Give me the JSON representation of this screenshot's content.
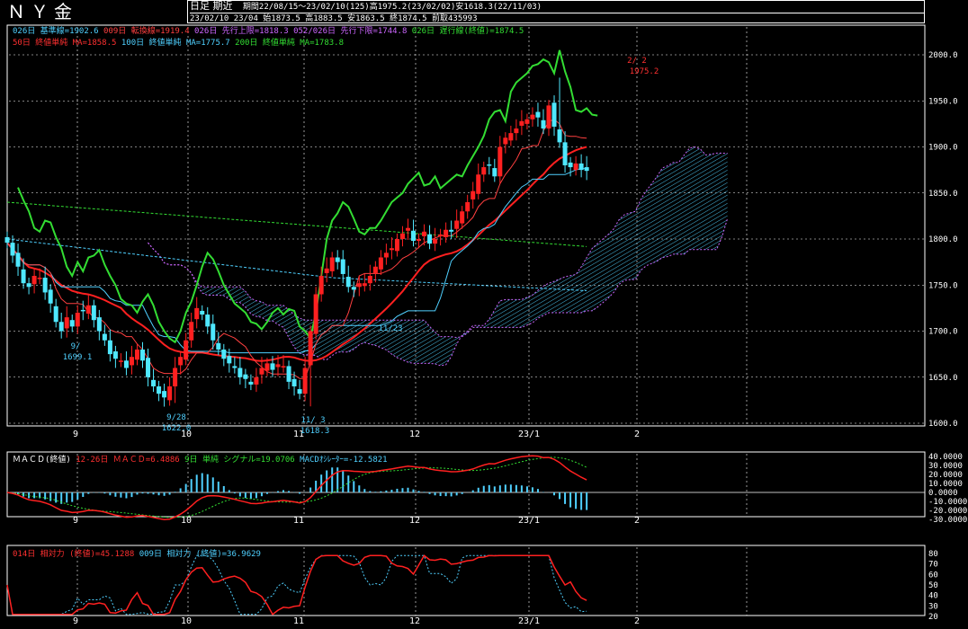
{
  "header": {
    "title": "ＮＹ金",
    "period_type": "日足 期近",
    "range_info": "期間22/08/15～23/02/10(125)高1975.2(23/02/02)安1618.3(22/11/03)",
    "ohlc_info": "23/02/10 23/04 始1873.5 高1883.5 安1863.5 終1874.5 前取435993"
  },
  "main_legend_line1": [
    {
      "text": "026日 基準線=1902.6",
      "color": "#4fd0ff"
    },
    {
      "text": "009日 転換線=1919.4",
      "color": "#ff4040"
    },
    {
      "text": "026日 先行上限=1818.3",
      "color": "#cc66ff"
    },
    {
      "text": "052/026日 先行下限=1744.8",
      "color": "#cc66ff"
    },
    {
      "text": "026日 遅行線(終値)=1874.5",
      "color": "#33dd33"
    }
  ],
  "main_legend_line2": [
    {
      "text": "50日 終値単純 MA=1858.5",
      "color": "#ff3030"
    },
    {
      "text": "100日 終値単純 MA=1775.7",
      "color": "#4fd0ff"
    },
    {
      "text": "200日 終値単純 MA=1783.8",
      "color": "#33dd33"
    }
  ],
  "macd_legend": [
    {
      "text": "ＭＡＣＤ(終値)",
      "color": "#ffffff"
    },
    {
      "text": "12-26日 ＭＡＣＤ=6.4886",
      "color": "#ff3030"
    },
    {
      "text": "9日 単純 シグナル=19.0706",
      "color": "#33dd33"
    },
    {
      "text": "MACDｵｼﾚｰﾀｰ=-12.5821",
      "color": "#4fd0ff"
    }
  ],
  "rsi_legend": [
    {
      "text": "014日 相対力 (終値)=45.1288",
      "color": "#ff3030"
    },
    {
      "text": "009日 相対力 (終値)=36.9629",
      "color": "#4fd0ff"
    }
  ],
  "x_labels": [
    "9",
    "10",
    "11",
    "12",
    "23/1",
    "2"
  ],
  "annotations": {
    "high": [
      "2/ 2",
      "1975.2"
    ],
    "low_sep": [
      "9/28",
      "1622.0"
    ],
    "low_nov": [
      "11/ 3",
      "1618.3"
    ],
    "left_low": [
      "9/",
      "1699.1"
    ],
    "nov_mid": "11/23"
  },
  "chart_data": [
    {
      "type": "candlestick",
      "title": "ＮＹ金 日足 期近",
      "ylim": [
        1600,
        2000
      ],
      "y_ticks": [
        "2000.0",
        "1950.0",
        "1900.0",
        "1850.0",
        "1800.0",
        "1750.0",
        "1700.0",
        "1650.0",
        "1600.0"
      ],
      "x_tick_labels": [
        "9",
        "10",
        "11",
        "12",
        "23/1",
        "2"
      ],
      "closes": [
        1796,
        1782,
        1770,
        1752,
        1748,
        1760,
        1758,
        1742,
        1730,
        1710,
        1700,
        1715,
        1705,
        1720,
        1722,
        1728,
        1712,
        1700,
        1690,
        1675,
        1670,
        1668,
        1660,
        1672,
        1680,
        1668,
        1650,
        1640,
        1632,
        1628,
        1640,
        1660,
        1672,
        1690,
        1710,
        1725,
        1718,
        1705,
        1690,
        1680,
        1670,
        1665,
        1660,
        1650,
        1648,
        1642,
        1650,
        1660,
        1665,
        1658,
        1664,
        1662,
        1645,
        1640,
        1632,
        1660,
        1700,
        1740,
        1760,
        1768,
        1780,
        1775,
        1762,
        1748,
        1745,
        1752,
        1752,
        1760,
        1770,
        1780,
        1785,
        1790,
        1800,
        1806,
        1812,
        1798,
        1800,
        1808,
        1795,
        1800,
        1805,
        1810,
        1808,
        1820,
        1830,
        1840,
        1852,
        1870,
        1878,
        1880,
        1868,
        1900,
        1910,
        1915,
        1920,
        1928,
        1930,
        1935,
        1932,
        1920,
        1945,
        1922,
        1905,
        1880,
        1878,
        1882,
        1875,
        1874
      ],
      "ichimoku_kijun_last": 1902.6,
      "ichimoku_tenkan_last": 1919.4,
      "senkou_a_last": 1818.3,
      "senkou_b_last": 1744.8,
      "chikou_last": 1874.5,
      "ma50_last": 1858.5,
      "ma100_last": 1775.7,
      "ma200_last": 1783.8
    },
    {
      "type": "line",
      "title": "ＭＡＣＤ(終値)",
      "ylim": [
        -30,
        40
      ],
      "y_ticks": [
        "40.0000",
        "30.0000",
        "20.0000",
        "10.0000",
        "0.0000",
        "-10.0000",
        "-20.0000",
        "-30.0000"
      ],
      "macd_last": 6.4886,
      "signal_last": 19.0706,
      "oscillator_last": -12.5821
    },
    {
      "type": "line",
      "title": "相対力 (終値)",
      "ylim": [
        20,
        80
      ],
      "y_ticks": [
        "80",
        "70",
        "60",
        "50",
        "40",
        "30",
        "20"
      ],
      "rsi14_last": 45.1288,
      "rsi9_last": 36.9629
    }
  ]
}
